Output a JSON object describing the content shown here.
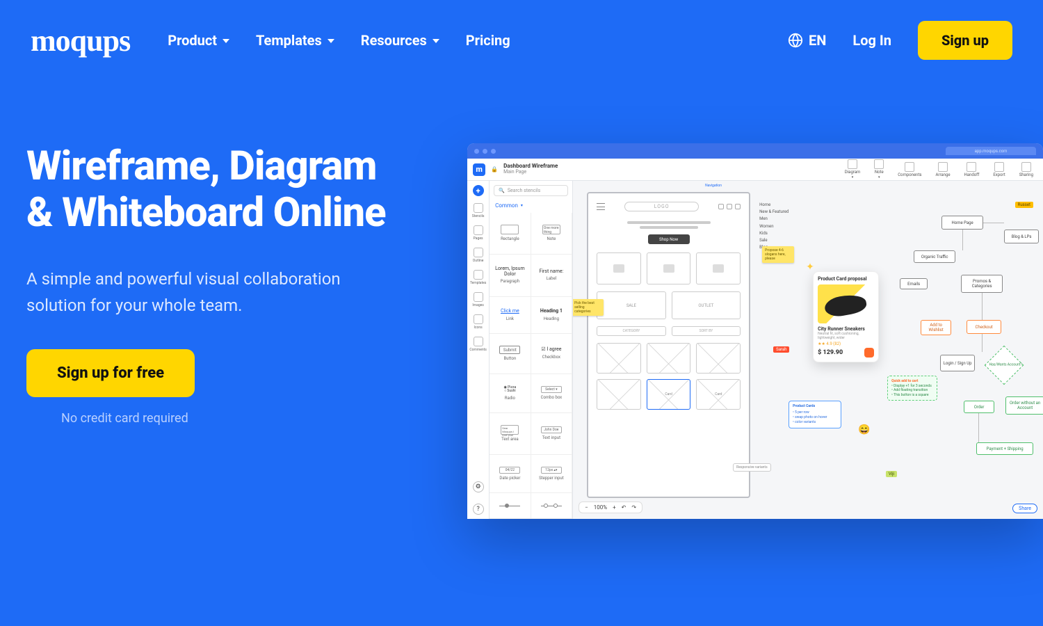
{
  "brand": "moqups",
  "nav": {
    "items": [
      "Product",
      "Templates",
      "Resources",
      "Pricing"
    ],
    "lang": "EN",
    "login": "Log In",
    "signup": "Sign up"
  },
  "hero": {
    "title_line1": "Wireframe, Diagram",
    "title_line2": "& Whiteboard Online",
    "subtitle": "A simple and powerful visual collaboration solution for your whole team.",
    "cta": "Sign up for free",
    "cc_note": "No credit card required"
  },
  "app": {
    "url_tab": "app.moqups.com",
    "doc_title": "Dashboard Wireframe",
    "doc_sub": "Main Page",
    "tools": [
      "Diagram",
      "Note",
      "Components",
      "Arrange",
      "Handoff",
      "Export",
      "Sharing"
    ],
    "rail": [
      "Stencils",
      "Pages",
      "Outline",
      "Templates",
      "Images",
      "Icons",
      "Comments"
    ],
    "search_placeholder": "Search stencils",
    "category": "Common",
    "stencils": [
      {
        "shape": "rect",
        "label": "Rectangle"
      },
      {
        "shape": "note",
        "label": "Note",
        "text": "One more thing"
      },
      {
        "shape": "para",
        "label": "Paragraph",
        "text": "Lorem, Ipsum Dolor"
      },
      {
        "shape": "label",
        "label": "Label",
        "text": "First name:"
      },
      {
        "shape": "link",
        "label": "Link",
        "text": "Click me"
      },
      {
        "shape": "heading",
        "label": "Heading",
        "text": "Heading 1"
      },
      {
        "shape": "btn",
        "label": "Button",
        "text": "Submit"
      },
      {
        "shape": "check",
        "label": "Checkbox",
        "text": "I agree"
      },
      {
        "shape": "radio",
        "label": "Radio",
        "text": "Pizza / Sushi"
      },
      {
        "shape": "combo",
        "label": "Combo box",
        "text": "Select ▾"
      },
      {
        "shape": "textarea",
        "label": "Text area",
        "text": "Dear Moqups I love you!"
      },
      {
        "shape": "input",
        "label": "Text input",
        "text": "John Doe"
      },
      {
        "shape": "date",
        "label": "Date picker",
        "text": "04/22"
      },
      {
        "shape": "step",
        "label": "Stepper input",
        "text": "12px ▴▾"
      },
      {
        "shape": "slider",
        "label": "",
        "text": ""
      },
      {
        "shape": "slider2",
        "label": "",
        "text": ""
      }
    ],
    "zoom": "100%",
    "share": "Share",
    "wireframe": {
      "logo": "LOGO",
      "cta": "Shop Now",
      "sale": "SALE",
      "outlet": "OUTLET",
      "category": "CATEGORY",
      "sortby": "SORT BY",
      "card": "Card",
      "responsive": "Responsive variants",
      "nav_label": "Navigation"
    },
    "sidelist": [
      "Home",
      "New & Featured",
      "Men",
      "Women",
      "Kids",
      "Sale",
      "Blog"
    ],
    "sticky1": "Propose 4-6 slogans here, please",
    "sticky2": "Pick the best selling categories",
    "proposal": {
      "heading": "Product Card proposal",
      "name": "City Runner Sneakers",
      "sub": "Neutral fit, soft cushioning, lightweight, wider",
      "reviews": "★★  4.9 (82)",
      "price": "$ 129.90"
    },
    "bluenote": {
      "title": "Product Cards",
      "lines": [
        "5 per row",
        "swap photo on hover",
        "color variants"
      ]
    },
    "greennote": {
      "title": "Quick add to cart",
      "lines": [
        "Display +1 for 3 seconds",
        "Add floating transition",
        "This button is a square"
      ]
    },
    "cursors": {
      "sarah": "Sarah",
      "russet": "Russet",
      "viji": "Viji"
    },
    "flow": {
      "home": "Home Page",
      "blog": "Blog & LPs",
      "organic": "Organic Traffic",
      "emails": "Emails",
      "promos": "Promos & Categories",
      "wishlist": "Add to Wishlist",
      "checkout": "Checkout",
      "login": "Login / Sign Up",
      "diamond": "Has/Wants Account?",
      "order": "Order",
      "order_noacct": "Order without an Account",
      "payship": "Payment + Shipping"
    }
  }
}
